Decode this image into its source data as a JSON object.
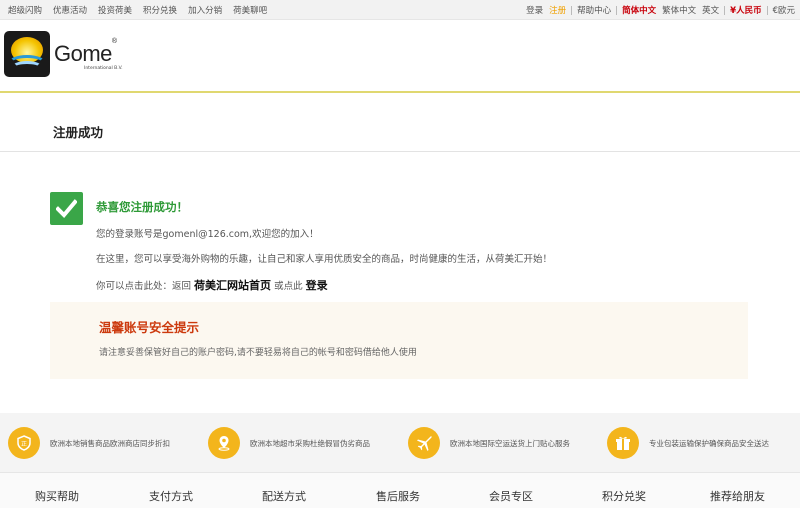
{
  "topbar": {
    "left_links": [
      "超级闪购",
      "优惠活动",
      "投资荷美",
      "积分兑换",
      "加入分销",
      "荷美聊吧"
    ],
    "login": "登录",
    "register": "注册",
    "help": "帮助中心",
    "lang_simplified": "简体中文",
    "lang_traditional": "繁体中文",
    "lang_english": "英文",
    "currency_cny": "¥人民币",
    "currency_eur": "€欧元"
  },
  "brand": {
    "name": "Gome",
    "registered": "®",
    "sub": "International B.V."
  },
  "page": {
    "title": "注册成功"
  },
  "success": {
    "title": "恭喜您注册成功！",
    "account_line": "您的登录账号是gomenl@126.com,欢迎您的加入！",
    "info_line": "在这里，您可以享受海外购物的乐趣，让自己和家人享用优质安全的商品，时尚健康的生活，从荷美汇开始！",
    "nav_prefix": "你可以点击此处：返回",
    "home_link": "荷美汇网站首页",
    "nav_middle": "或点此",
    "login_link": "登录"
  },
  "notice": {
    "title": "温馨账号安全提示",
    "text": "请注意妥善保管好自己的账户密码,请不要轻易将自己的帐号和密码借给他人使用"
  },
  "features": [
    {
      "icon": "shield-icon",
      "text": "欧洲本地销售商品欧洲商店同步折扣"
    },
    {
      "icon": "location-pin-icon",
      "text": "欧洲本地超市采购杜绝假冒伪劣商品"
    },
    {
      "icon": "airplane-icon",
      "text": "欧洲本地国际空运送货上门贴心服务"
    },
    {
      "icon": "gift-icon",
      "text": "专业包装运输保护确保商品安全送达"
    }
  ],
  "footer_nav": [
    "购买帮助",
    "支付方式",
    "配送方式",
    "售后服务",
    "会员专区",
    "积分兑奖",
    "推荐给朋友"
  ],
  "colors": {
    "success_green": "#2e9a37",
    "notice_red": "#cc3a0e",
    "feature_yellow": "#f3b51c",
    "header_line": "#e0d870"
  }
}
